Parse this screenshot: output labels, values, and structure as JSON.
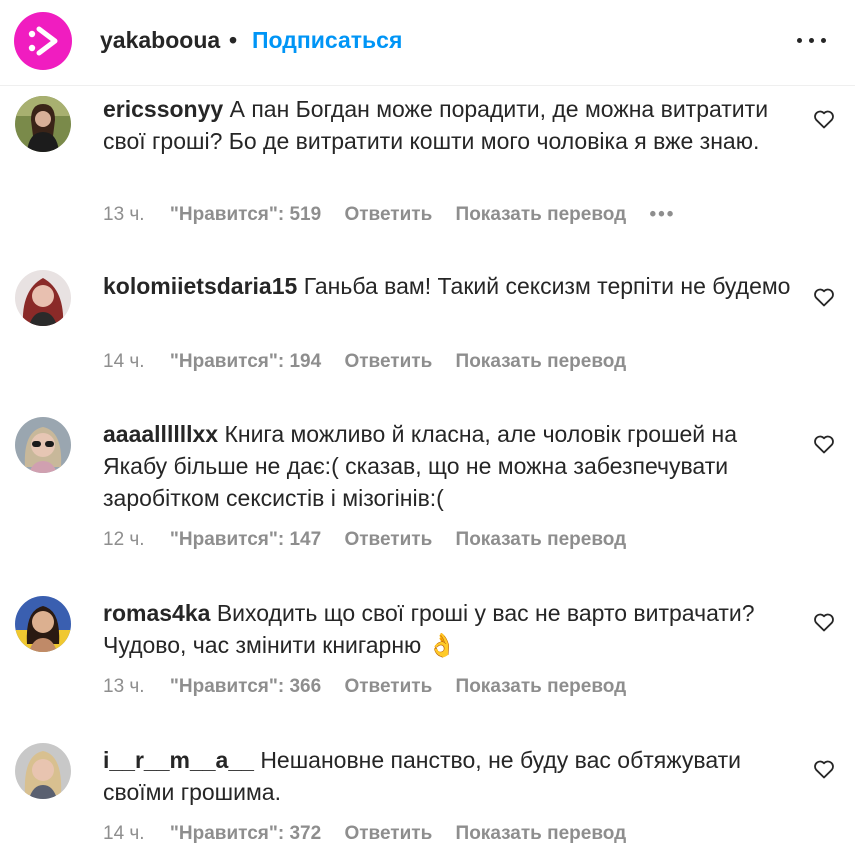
{
  "header": {
    "username": "yakabooua",
    "separator": "•",
    "follow_label": "Подписаться",
    "more_icon": "more-horizontal-icon"
  },
  "comments": [
    {
      "username": "ericssonyy",
      "text": "А пан Богдан може порадити, де можна витратити свої гроші? Бо де витратити кошти мого чоловіка я вже знаю.",
      "time": "13 ч.",
      "likes": "\"Нравится\": 519",
      "reply": "Ответить",
      "translate": "Показать перевод",
      "more": "•••"
    },
    {
      "username": "kolomiietsdaria15",
      "text": "Ганьба вам! Такий сексизм терпіти не будемо",
      "time": "14 ч.",
      "likes": "\"Нравится\": 194",
      "reply": "Ответить",
      "translate": "Показать перевод"
    },
    {
      "username": "aaaallllllxx",
      "text": "Книга можливо й класна, але чоловік грошей на Якабу більше не дає:( сказав, що не можна забезпечувати заробітком сексистів і мізогінів:(",
      "time": "12 ч.",
      "likes": "\"Нравится\": 147",
      "reply": "Ответить",
      "translate": "Показать перевод"
    },
    {
      "username": "romas4ka",
      "text": "Виходить що свої гроші у вас не варто витрачати? Чудово, час змінити книгарню 👌",
      "time": "13 ч.",
      "likes": "\"Нравится\": 366",
      "reply": "Ответить",
      "translate": "Показать перевод"
    },
    {
      "username": "i__r__m__a__",
      "text": "Нешановне панство, не буду вас обтяжувати своїми грошима.",
      "time": "14 ч.",
      "likes": "\"Нравится\": 372",
      "reply": "Ответить",
      "translate": "Показать перевод"
    }
  ],
  "colors": {
    "brand": "#f01dc0",
    "link": "#0095f6",
    "meta": "#8e8e8e",
    "text": "#262626"
  }
}
